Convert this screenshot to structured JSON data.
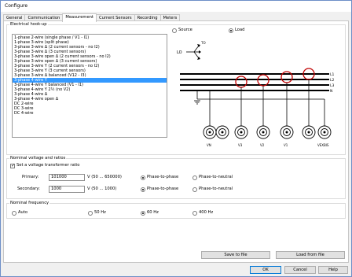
{
  "window": {
    "title": "Configure"
  },
  "tabs": [
    {
      "label": "General"
    },
    {
      "label": "Communication"
    },
    {
      "label": "Measurement"
    },
    {
      "label": "Current Sensors"
    },
    {
      "label": "Recording"
    },
    {
      "label": "Meters"
    }
  ],
  "active_tab": "Measurement",
  "hookup": {
    "title": "Electrical hook-up",
    "items": [
      "1-phase 2-wire (single phase / V1 - I1)",
      "1-phase 3-wire (split phase)",
      "3-phase 3-wire Δ (2 current sensors - no I2)",
      "3-phase 3-wire Δ (3 current sensors)",
      "3-phase 3-wire open Δ (2 current sensors - no I2)",
      "3-phase 3-wire open Δ (3 current sensors)",
      "3-phase 3-wire Y (2 current sensors - no I2)",
      "3-phase 3-wire Y (3 current sensors)",
      "3-phase 3-wire Δ balanced (V12 - I3)",
      "3-phase 4-wire Y",
      "3-phase 4-wire Y balanced (V1 - I1)",
      "3-phase 4-wire Y 2½ (no V2)",
      "3-phase 4-wire Δ",
      "3-phase 4-wire open Δ",
      "DC 2-wire",
      "DC 3-wire",
      "DC 4-wire"
    ],
    "selected_index": 9,
    "source_label": "Source",
    "load_label": "Load",
    "load_selected": true,
    "diagram": {
      "lo_label": "LO",
      "to_label": "TO",
      "line_labels": [
        "L1",
        "L2",
        "L3",
        "N"
      ],
      "terminal_labels": [
        "VN",
        "V3",
        "V2",
        "V1",
        "VEXBIS"
      ]
    }
  },
  "nominal_voltage": {
    "title": "Nominal voltage and ratios",
    "checkbox_label": "Set a voltage transformer ratio",
    "checked": true,
    "primary_label": "Primary:",
    "primary_value": "101000",
    "primary_range": "V (50 ... 650000)",
    "secondary_label": "Secondary:",
    "secondary_value": "1000",
    "secondary_range": "V (50 ... 1000)",
    "phase_to_phase": "Phase-to-phase",
    "phase_to_neutral": "Phase-to-neutral"
  },
  "nominal_frequency": {
    "title": "Nominal frequency",
    "options": [
      "Auto",
      "50 Hz",
      "60 Hz",
      "400 Hz"
    ],
    "selected": "60 Hz"
  },
  "buttons": {
    "save": "Save to file",
    "load": "Load from file",
    "ok": "OK",
    "cancel": "Cancel",
    "help": "Help"
  }
}
